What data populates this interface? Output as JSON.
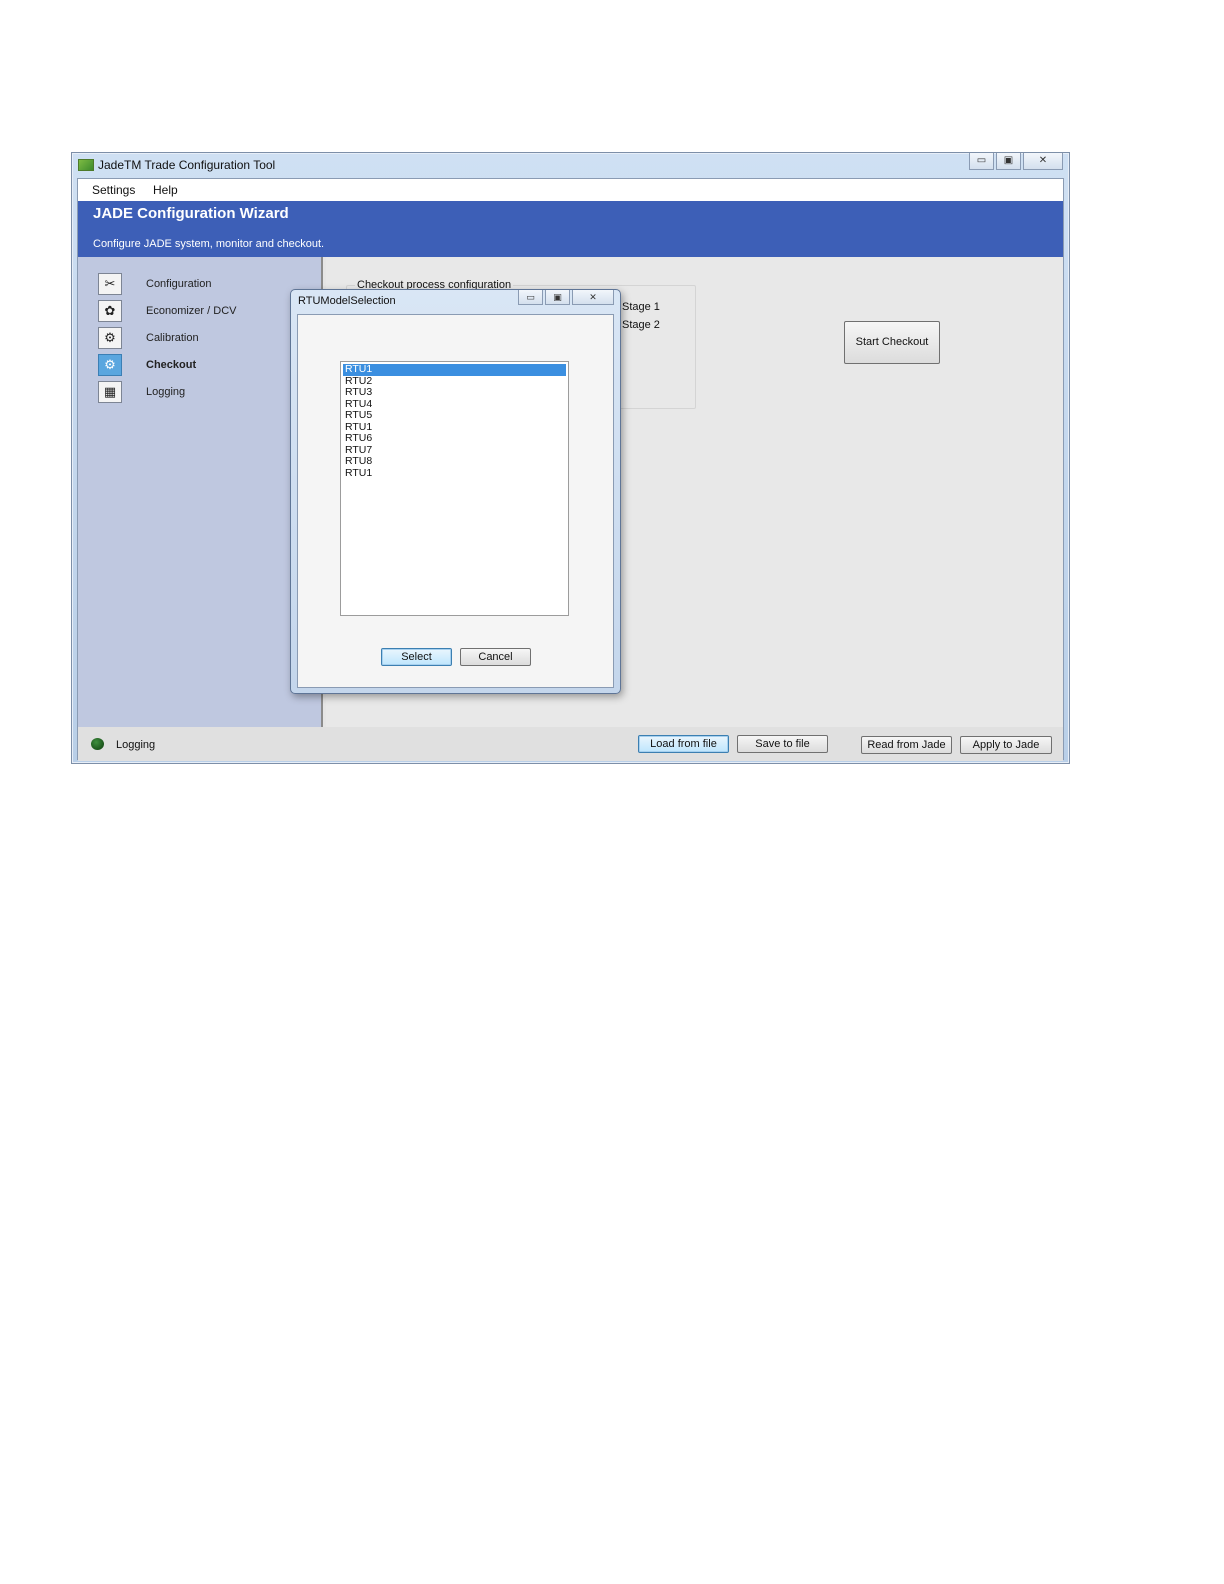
{
  "window": {
    "title": "JadeTM Trade Configuration Tool",
    "controls": {
      "minimize": "▭",
      "maximize": "▣",
      "close": "✕"
    }
  },
  "menu": {
    "items": [
      "Settings",
      "Help"
    ]
  },
  "banner": {
    "title": "JADE Configuration Wizard",
    "subtitle": "Configure JADE system, monitor and checkout."
  },
  "sidebar": {
    "items": [
      {
        "label": "Configuration",
        "icon": "tools-icon",
        "glyph": "✂",
        "active": false
      },
      {
        "label": "Economizer / DCV",
        "icon": "economizer-icon",
        "glyph": "✿",
        "active": false
      },
      {
        "label": "Calibration",
        "icon": "calibration-icon",
        "glyph": "⚙",
        "active": false
      },
      {
        "label": "Checkout",
        "icon": "checkout-icon",
        "glyph": "⚙",
        "active": true
      },
      {
        "label": "Logging",
        "icon": "logging-icon",
        "glyph": "▦",
        "active": false
      }
    ]
  },
  "main": {
    "group_caption": "Checkout process configuration",
    "stages": [
      "Stage 1",
      "Stage 2"
    ],
    "start_button": "Start Checkout"
  },
  "status": {
    "label": "Logging",
    "led_color": "#1f5f1f",
    "buttons": {
      "load": "Load from file",
      "save": "Save to  file",
      "read": "Read from Jade",
      "apply": "Apply to Jade"
    }
  },
  "dialog": {
    "title": "RTUModelSelection",
    "controls": {
      "minimize": "▭",
      "maximize": "▣",
      "close": "✕"
    },
    "list_items": [
      "RTU1",
      "RTU2",
      "RTU3",
      "RTU4",
      "RTU5",
      "RTU1",
      "RTU6",
      "RTU7",
      "RTU8",
      "RTU1"
    ],
    "selected_index": 0,
    "select_button": "Select",
    "cancel_button": "Cancel"
  },
  "colors": {
    "banner": "#3d5fb7",
    "sidebar": "#bfc8e0",
    "selection": "#3b8fe0"
  }
}
